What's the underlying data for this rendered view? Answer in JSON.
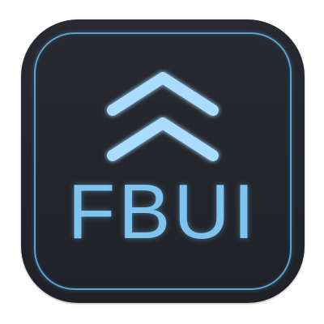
{
  "app_icon": {
    "text": "FBUI",
    "icon_name": "double-chevron-up-icon",
    "colors": {
      "background": "#23262b",
      "accent": "#7ec4ef",
      "border": "#5aa2cf"
    }
  }
}
